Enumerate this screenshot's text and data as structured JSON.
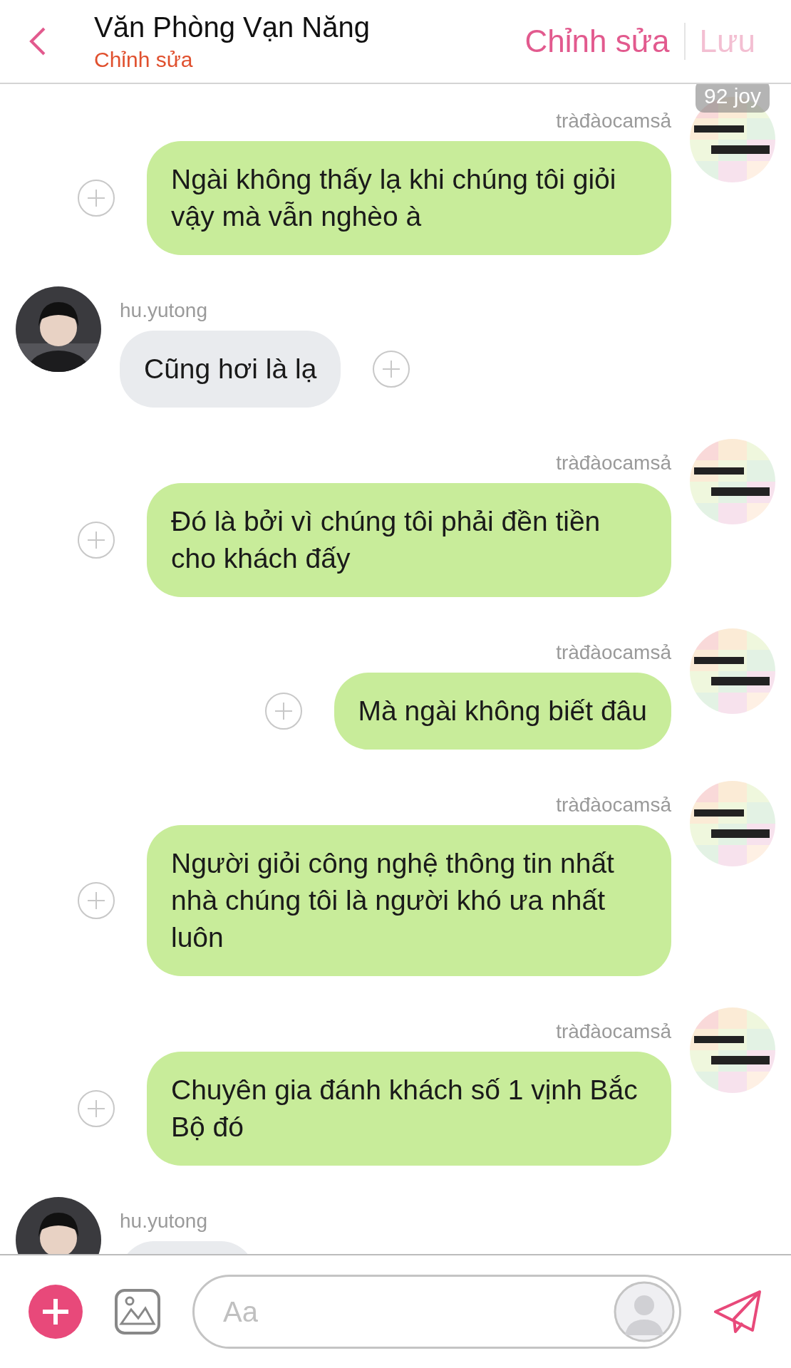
{
  "header": {
    "title": "Văn Phòng Vạn Năng",
    "subtitle": "Chỉnh sửa",
    "actions": [
      {
        "label": "Chỉnh sửa",
        "disabled": false
      },
      {
        "label": "Lưu",
        "disabled": true
      }
    ]
  },
  "messages": [
    {
      "kind": "outgoing",
      "sender": "tràđàocamsả",
      "badge": "92 joy",
      "text": "Ngài không thấy lạ khi chúng tôi giỏi vậy mà vẫn nghèo à"
    },
    {
      "kind": "incoming",
      "sender": "hu.yutong",
      "text": "Cũng hơi là lạ"
    },
    {
      "kind": "outgoing",
      "sender": "tràđàocamsả",
      "text": "Đó là bởi vì chúng tôi phải đền tiền cho khách đấy"
    },
    {
      "kind": "outgoing",
      "sender": "tràđàocamsả",
      "text": "Mà ngài không biết đâu"
    },
    {
      "kind": "outgoing",
      "sender": "tràđàocamsả",
      "text": "Người giỏi công nghệ thông tin nhất nhà chúng tôi là người khó ưa nhất luôn"
    },
    {
      "kind": "outgoing",
      "sender": "tràđàocamsả",
      "text": "Chuyên gia đánh khách số 1 vịnh Bắc Bộ đó"
    },
    {
      "kind": "incoming",
      "sender": "hu.yutong"
    }
  ],
  "composer": {
    "placeholder": "Aa"
  }
}
